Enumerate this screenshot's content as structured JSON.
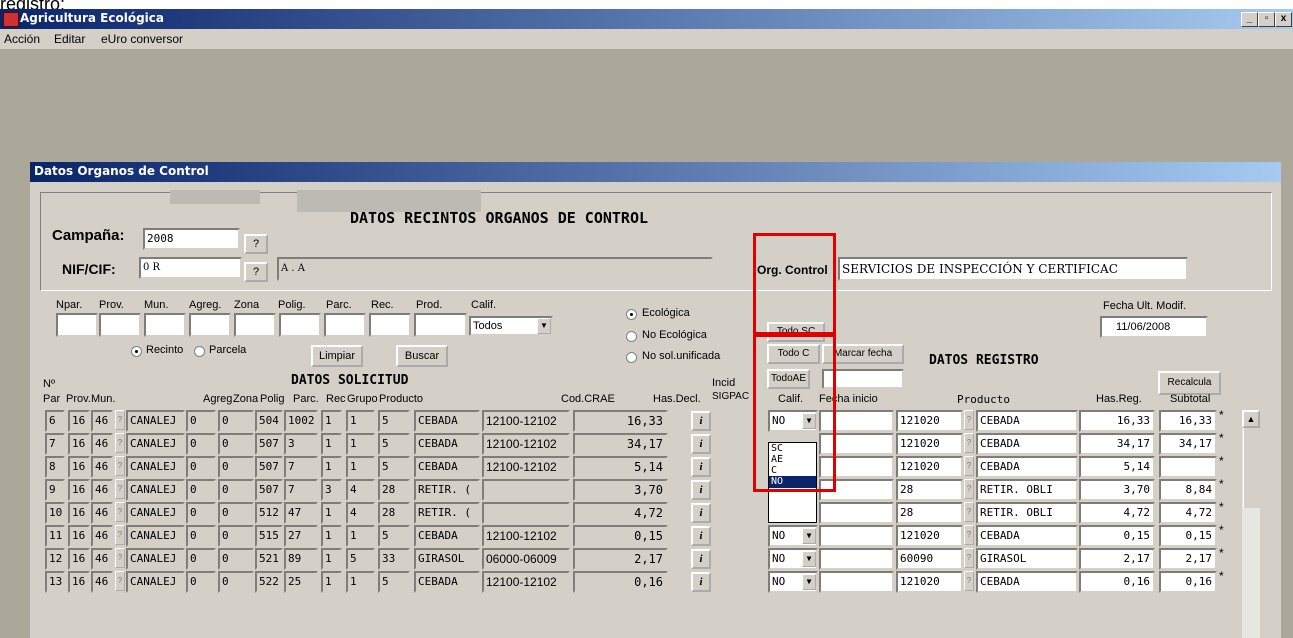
{
  "top_text": "registro:",
  "window": {
    "title": "Agricultura Ecológica",
    "controls": [
      "_",
      "8",
      "x"
    ]
  },
  "menu": [
    "Acción",
    "Editar",
    "eUro conversor"
  ],
  "child_title": "Datos Organos de Control",
  "header": {
    "main_title": "DATOS RECINTOS ORGANOS DE CONTROL",
    "campana_label": "Campaña:",
    "campana_value": "2008",
    "nif_label": "NIF/CIF:",
    "nif_value": "0            R",
    "name_value": "A                          .          A",
    "q": "?",
    "org_label": "Org. Control",
    "org_value": "SERVICIOS DE INSPECCIÓN Y CERTIFICAC",
    "fecha_label": "Fecha Ult. Modif.",
    "fecha_value": "11/06/2008"
  },
  "filters": {
    "labels": [
      "Npar.",
      "Prov.",
      "Mun.",
      "Agreg.",
      "Zona",
      "Polig.",
      "Parc.",
      "Rec.",
      "Prod.",
      "Calif."
    ],
    "calif_value": "Todos",
    "radio_recinto": "Recinto",
    "radio_parcela": "Parcela",
    "limpiar": "Limpiar",
    "buscar": "Buscar",
    "radio_eco": "Ecológica",
    "radio_noeco": "No Ecológica",
    "radio_nosol": "No sol.unificada"
  },
  "buttons": {
    "todo_sc": "Todo SC",
    "todo_c": "Todo C",
    "marcar_fecha": "Marcar fecha",
    "todo_ae": "TodoAE",
    "recalcula": "Recalcula"
  },
  "solicitud_title": "DATOS SOLICITUD",
  "registro_title": "DATOS REGISTRO",
  "col_headers": {
    "no": "Nº",
    "par": "Par",
    "prov": "Prov.",
    "mun": "Mun.",
    "agreg": "Agreg",
    "zona": "Zona",
    "polig": "Polig",
    "parc": "Parc.",
    "rec": "Rec",
    "grupo": "Grupo",
    "producto": "Producto",
    "cod": "Cod.CRAE",
    "has": "Has.Decl.",
    "incid": "Incid",
    "sigpac": "SIGPAC",
    "calif": "Calif.",
    "fecha": "Fecha inicio",
    "producto2": "Producto",
    "hasreg": "Has.Reg.",
    "subtotal": "Subtotal"
  },
  "rows": [
    {
      "par": "6",
      "prov": "16",
      "mun": "46",
      "agreg": "CANALEJ",
      "zona": "0",
      "x": "0",
      "polig": "504",
      "parc": "1002",
      "rec": "1",
      "grupo": "1",
      "prod": "5",
      "producto": "CEBADA",
      "cod": "12100-12102",
      "has": "16,33",
      "calif": "NO",
      "fecha": "",
      "pcode": "121020",
      "pname": "CEBADA",
      "hasreg": "16,33",
      "subtotal": "16,33",
      "star": "*"
    },
    {
      "par": "7",
      "prov": "16",
      "mun": "46",
      "agreg": "CANALEJ",
      "zona": "0",
      "x": "0",
      "polig": "507",
      "parc": "3",
      "rec": "1",
      "grupo": "1",
      "prod": "5",
      "producto": "CEBADA",
      "cod": "12100-12102",
      "has": "34,17",
      "calif": "",
      "fecha": "",
      "pcode": "121020",
      "pname": "CEBADA",
      "hasreg": "34,17",
      "subtotal": "34,17",
      "star": "*"
    },
    {
      "par": "8",
      "prov": "16",
      "mun": "46",
      "agreg": "CANALEJ",
      "zona": "0",
      "x": "0",
      "polig": "507",
      "parc": "7",
      "rec": "1",
      "grupo": "1",
      "prod": "5",
      "producto": "CEBADA",
      "cod": "12100-12102",
      "has": "5,14",
      "calif": "",
      "fecha": "",
      "pcode": "121020",
      "pname": "CEBADA",
      "hasreg": "5,14",
      "subtotal": "",
      "star": "*"
    },
    {
      "par": "9",
      "prov": "16",
      "mun": "46",
      "agreg": "CANALEJ",
      "zona": "0",
      "x": "0",
      "polig": "507",
      "parc": "7",
      "rec": "3",
      "grupo": "4",
      "prod": "28",
      "producto": "RETIR. (",
      "cod": "",
      "has": "3,70",
      "calif": "",
      "fecha": "",
      "pcode": "28",
      "pname": "RETIR. OBLI",
      "hasreg": "3,70",
      "subtotal": "8,84",
      "star": "*"
    },
    {
      "par": "10",
      "prov": "16",
      "mun": "46",
      "agreg": "CANALEJ",
      "zona": "0",
      "x": "0",
      "polig": "512",
      "parc": "47",
      "rec": "1",
      "grupo": "4",
      "prod": "28",
      "producto": "RETIR. (",
      "cod": "",
      "has": "4,72",
      "calif": "",
      "fecha": "",
      "pcode": "28",
      "pname": "RETIR. OBLI",
      "hasreg": "4,72",
      "subtotal": "4,72",
      "star": "*"
    },
    {
      "par": "11",
      "prov": "16",
      "mun": "46",
      "agreg": "CANALEJ",
      "zona": "0",
      "x": "0",
      "polig": "515",
      "parc": "27",
      "rec": "1",
      "grupo": "1",
      "prod": "5",
      "producto": "CEBADA",
      "cod": "12100-12102",
      "has": "0,15",
      "calif": "NO",
      "fecha": "",
      "pcode": "121020",
      "pname": "CEBADA",
      "hasreg": "0,15",
      "subtotal": "0,15",
      "star": "*"
    },
    {
      "par": "12",
      "prov": "16",
      "mun": "46",
      "agreg": "CANALEJ",
      "zona": "0",
      "x": "0",
      "polig": "521",
      "parc": "89",
      "rec": "1",
      "grupo": "5",
      "prod": "33",
      "producto": "GIRASOL",
      "cod": "06000-06009",
      "has": "2,17",
      "calif": "NO",
      "fecha": "",
      "pcode": "60090",
      "pname": "GIRASOL",
      "hasreg": "2,17",
      "subtotal": "2,17",
      "star": "*"
    },
    {
      "par": "13",
      "prov": "16",
      "mun": "46",
      "agreg": "CANALEJ",
      "zona": "0",
      "x": "0",
      "polig": "522",
      "parc": "25",
      "rec": "1",
      "grupo": "1",
      "prod": "5",
      "producto": "CEBADA",
      "cod": "12100-12102",
      "has": "0,16",
      "calif": "NO",
      "fecha": "",
      "pcode": "121020",
      "pname": "CEBADA",
      "hasreg": "0,16",
      "subtotal": "0,16",
      "star": "*"
    }
  ],
  "dropdown_options": [
    "SC",
    "AE",
    "C",
    "NO"
  ],
  "dropdown_selected": "NO",
  "row_btn_q": "?",
  "row_btn_i": "i"
}
